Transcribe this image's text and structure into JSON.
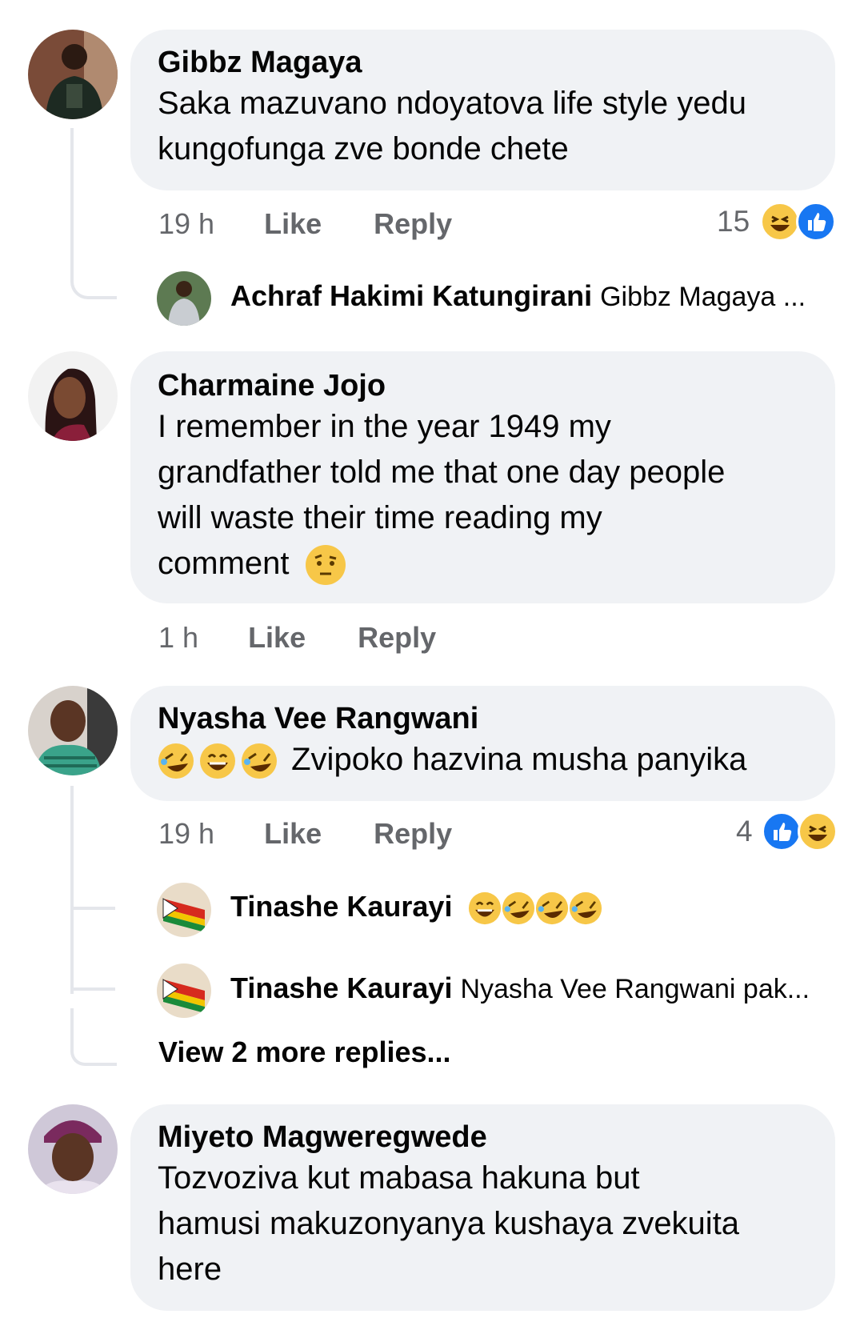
{
  "comments": [
    {
      "name": "Gibbz Magaya",
      "text_lines": [
        "Saka mazuvano ndoyatova life style yedu",
        "kungofunga zve bonde chete"
      ],
      "time": "19 h",
      "like": "Like",
      "reply": "Reply",
      "reaction_count": "15",
      "reactions": [
        "haha-icon",
        "like-icon"
      ],
      "replies": [
        {
          "name": "Achraf Hakimi Katungirani",
          "preview": "Gibbz Magaya ..."
        }
      ]
    },
    {
      "name": "Charmaine Jojo",
      "text_lines": [
        "I remember in the year 1949 my",
        "grandfather told me that one day people",
        "will waste their time reading my",
        "comment"
      ],
      "time": "1 h",
      "like": "Like",
      "reply": "Reply"
    },
    {
      "name": "Nyasha Vee Rangwani",
      "text": "Zvipoko hazvina musha panyika",
      "time": "19 h",
      "like": "Like",
      "reply": "Reply",
      "reaction_count": "4",
      "reactions": [
        "like-icon",
        "haha-icon"
      ],
      "replies": [
        {
          "name": "Tinashe Kaurayi",
          "preview": ""
        },
        {
          "name": "Tinashe Kaurayi",
          "preview": "Nyasha Vee Rangwani pak..."
        }
      ],
      "view_more": "View 2 more replies..."
    },
    {
      "name": "Miyeto Magweregwede",
      "text_lines": [
        "Tozvoziva kut mabasa hakuna but",
        "hamusi makuzonyanya kushaya zvekuita",
        "here"
      ]
    }
  ],
  "colors": {
    "bubble": "#f0f2f5",
    "meta": "#65676b",
    "like_blue": "#1877f2",
    "haha_yellow": "#f7c748"
  }
}
